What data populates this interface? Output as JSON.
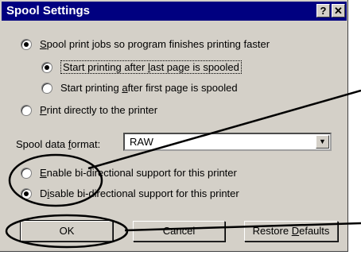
{
  "dialog": {
    "title": "Spool Settings",
    "help_glyph": "?",
    "close_glyph": "✕"
  },
  "options": {
    "spool": {
      "before": "",
      "key": "S",
      "after": "pool print jobs so program finishes printing faster",
      "checked": true
    },
    "after_last": {
      "before": "Start printing after ",
      "key": "l",
      "after": "ast page is spooled",
      "checked": true
    },
    "after_first": {
      "before": "Start printing ",
      "key": "a",
      "after": "fter first page is spooled",
      "checked": false
    },
    "direct": {
      "before": "",
      "key": "P",
      "after": "rint directly to the printer",
      "checked": false
    },
    "enable_bidi": {
      "before": "",
      "key": "E",
      "after": "nable bi-directional support for this printer",
      "checked": false
    },
    "disable_bidi": {
      "before": "D",
      "key": "i",
      "after": "sable bi-directional support for this printer",
      "checked": true
    }
  },
  "spool_format": {
    "label_before": "Spool data ",
    "label_key": "f",
    "label_after": "ormat:",
    "value": "RAW",
    "arrow_glyph": "▼"
  },
  "buttons": {
    "ok": "OK",
    "cancel": "Cancel",
    "restore_before": "Restore ",
    "restore_key": "D",
    "restore_after": "efaults"
  },
  "colors": {
    "titlebar": "#000080",
    "dialog_face": "#d4d0c8",
    "annotation": "#000000"
  }
}
